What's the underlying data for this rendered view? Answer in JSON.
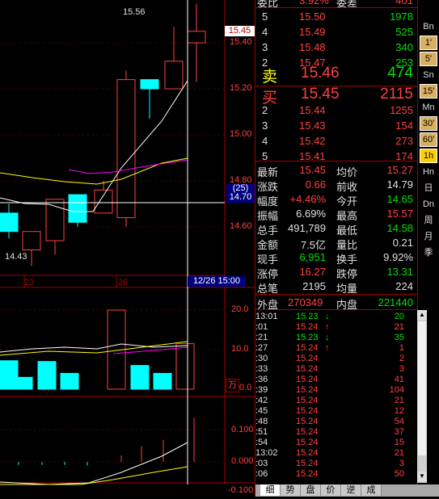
{
  "chart": {
    "price_labels": [
      "15.40",
      "15.20",
      "15.00",
      "14.80",
      "14.60"
    ],
    "current_price_tag": "15.45",
    "cross_tag": "(25)",
    "cross_price": "14.70",
    "high_label": "15.56",
    "low_label": "14.43",
    "date_labels": [
      "23",
      "26"
    ],
    "cross_date": "12/26 15:00",
    "vol_labels": [
      "20.0",
      "10.0",
      "0.0"
    ],
    "vol_unit": "万",
    "macd_labels": [
      "0.100",
      "0.000",
      "-0.100"
    ]
  },
  "chart_data": {
    "type": "candlestick",
    "candles": [
      {
        "open": 14.66,
        "close": 14.58,
        "high": 14.7,
        "low": 14.55
      },
      {
        "open": 14.5,
        "close": 14.58,
        "high": 14.58,
        "low": 14.43
      },
      {
        "open": 14.54,
        "close": 14.72,
        "high": 14.72,
        "low": 14.48
      },
      {
        "open": 14.74,
        "close": 14.62,
        "high": 14.74,
        "low": 14.6
      },
      {
        "open": 14.66,
        "close": 14.76,
        "high": 14.8,
        "low": 14.66
      },
      {
        "open": 14.64,
        "close": 15.24,
        "high": 15.28,
        "low": 14.6
      },
      {
        "open": 15.24,
        "close": 15.2,
        "high": 15.24,
        "low": 15.07
      },
      {
        "open": 15.2,
        "close": 15.32,
        "high": 15.47,
        "low": 15.2
      },
      {
        "open": 15.4,
        "close": 15.45,
        "high": 15.57,
        "low": 15.23
      }
    ],
    "volumes": [
      7.2,
      3.0,
      7.0,
      4.0,
      20.0,
      6.0,
      4.0,
      11.5
    ],
    "volume_unit": "万",
    "macd_bars": [
      -0.01,
      -0.01,
      -0.01,
      -0.012,
      0.02,
      0.05,
      0.07,
      0.09,
      0.14
    ],
    "ylim": [
      14.4,
      15.6
    ]
  },
  "header": {
    "wei_bi_label": "委比",
    "wei_bi_value": "3.92%",
    "wei_cha_label": "委差",
    "wei_cha_value": "401"
  },
  "sell": [
    {
      "level": "5",
      "price": "15.50",
      "vol": "1978"
    },
    {
      "level": "4",
      "price": "15.49",
      "vol": "525"
    },
    {
      "level": "3",
      "price": "15.48",
      "vol": "340"
    },
    {
      "level": "2",
      "price": "15.47",
      "vol": "253"
    },
    {
      "level": "卖",
      "price": "15.46",
      "vol": "474"
    }
  ],
  "buy": [
    {
      "level": "买",
      "price": "15.45",
      "vol": "2115"
    },
    {
      "level": "2",
      "price": "15.44",
      "vol": "1255"
    },
    {
      "level": "3",
      "price": "15.43",
      "vol": "154"
    },
    {
      "level": "4",
      "price": "15.42",
      "vol": "273"
    },
    {
      "level": "5",
      "price": "15.41",
      "vol": "174"
    }
  ],
  "stats": [
    {
      "l1": "最新",
      "v1": "15.45",
      "c1": "red",
      "l2": "均价",
      "v2": "15.27",
      "c2": "red"
    },
    {
      "l1": "涨跌",
      "v1": "0.66",
      "c1": "red",
      "l2": "前收",
      "v2": "14.79",
      "c2": "wht"
    },
    {
      "l1": "幅度",
      "v1": "+4.46%",
      "c1": "red",
      "l2": "今开",
      "v2": "14.65",
      "c2": "grn"
    },
    {
      "l1": "振幅",
      "v1": "6.69%",
      "c1": "wht",
      "l2": "最高",
      "v2": "15.57",
      "c2": "red"
    },
    {
      "l1": "总手",
      "v1": "491,789",
      "c1": "wht",
      "l2": "最低",
      "v2": "14.58",
      "c2": "grn"
    },
    {
      "l1": "金额",
      "v1": "7.5亿",
      "c1": "wht",
      "l2": "量比",
      "v2": "0.21",
      "c2": "wht"
    },
    {
      "l1": "现手",
      "v1": "6,951",
      "c1": "grn",
      "l2": "换手",
      "v2": "9.92%",
      "c2": "wht"
    },
    {
      "l1": "涨停",
      "v1": "16.27",
      "c1": "red",
      "l2": "跌停",
      "v2": "13.31",
      "c2": "grn"
    },
    {
      "l1": "总笔",
      "v1": "2195",
      "c1": "wht",
      "l2": "均量",
      "v2": "224",
      "c2": "wht"
    }
  ],
  "outer": {
    "label": "外盘",
    "value": "270349",
    "inner_label": "内盘",
    "inner_value": "221440"
  },
  "ticks": [
    {
      "t": "13:01",
      "p": "15.23",
      "a": "↓",
      "v": "20"
    },
    {
      "t": ":01",
      "p": "15.24",
      "a": "↑",
      "v": "21"
    },
    {
      "t": ":21",
      "p": "15.23",
      "a": "↓",
      "v": "35"
    },
    {
      "t": ":27",
      "p": "15.24",
      "a": "↑",
      "v": "1"
    },
    {
      "t": ":30",
      "p": "15.24",
      "a": "",
      "v": "2"
    },
    {
      "t": ":33",
      "p": "15.24",
      "a": "",
      "v": "3"
    },
    {
      "t": ":36",
      "p": "15.24",
      "a": "",
      "v": "41"
    },
    {
      "t": ":39",
      "p": "15.24",
      "a": "",
      "v": "104"
    },
    {
      "t": ":42",
      "p": "15.24",
      "a": "",
      "v": "21"
    },
    {
      "t": ":45",
      "p": "15.24",
      "a": "",
      "v": "12"
    },
    {
      "t": ":48",
      "p": "15.24",
      "a": "",
      "v": "54"
    },
    {
      "t": ":51",
      "p": "15.24",
      "a": "",
      "v": "37"
    },
    {
      "t": ":54",
      "p": "15.24",
      "a": "",
      "v": "15"
    },
    {
      "t": "13:02",
      "p": "15.24",
      "a": "",
      "v": "21"
    },
    {
      "t": ":03",
      "p": "15.24",
      "a": "",
      "v": "3"
    },
    {
      "t": ":06",
      "p": "15.24",
      "a": "",
      "v": "50"
    }
  ],
  "toolbar": [
    "Bn",
    "1'",
    "5'",
    "Sn",
    "15'",
    "Mn",
    "30'",
    "60'",
    "1h",
    "Hn",
    "日",
    "Dn",
    "周",
    "月",
    "季"
  ],
  "bottom_tabs": [
    "细",
    "势",
    "盘",
    "价",
    "逆",
    "成"
  ]
}
